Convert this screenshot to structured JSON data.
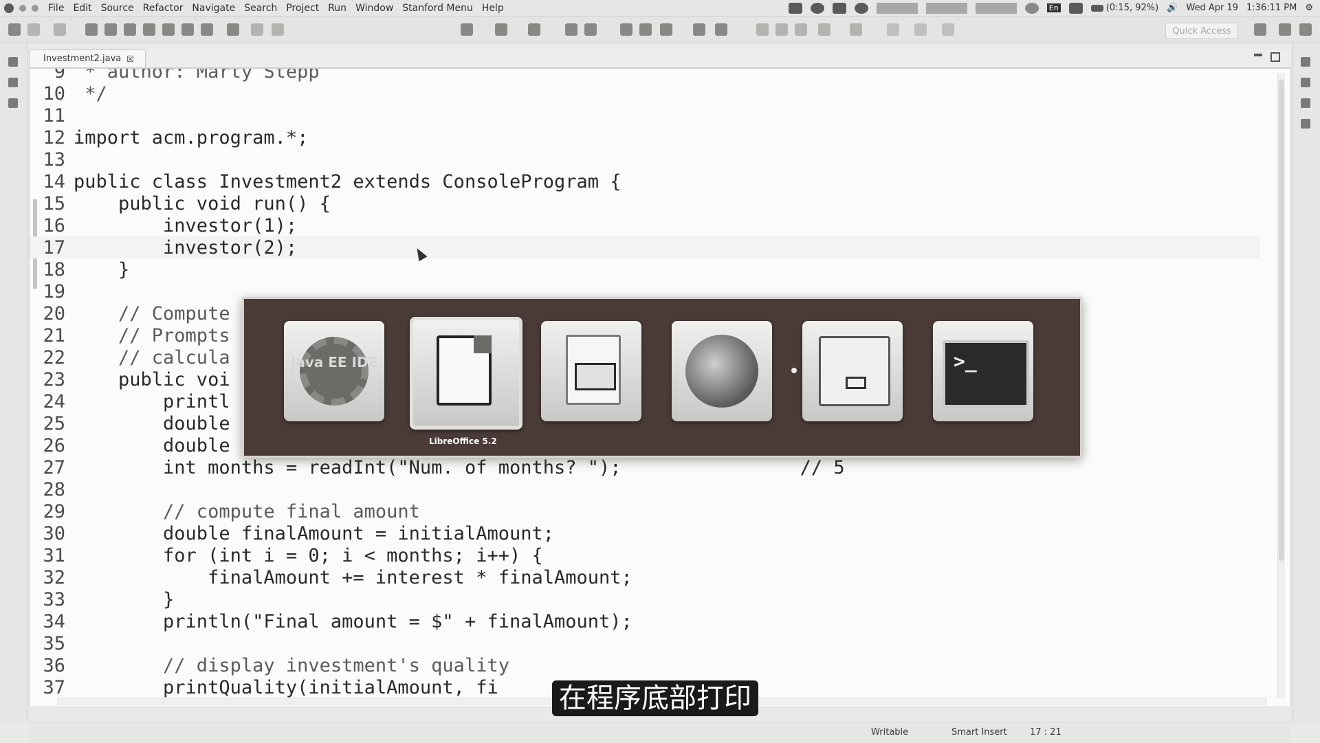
{
  "menubar": {
    "items": [
      "File",
      "Edit",
      "Source",
      "Refactor",
      "Navigate",
      "Search",
      "Project",
      "Run",
      "Window",
      "Stanford Menu",
      "Help"
    ],
    "battery": "(0:15, 92%)",
    "date": "Wed Apr 19",
    "time": "1:36:11 PM",
    "lang": "En"
  },
  "toolbar": {
    "quick_access": "Quick Access"
  },
  "editor": {
    "tab_title": "Investment2.java",
    "tab_close": "☒",
    "lines": [
      {
        "n": "9",
        "t": " * author: Marty Stepp"
      },
      {
        "n": "10",
        "t": " */"
      },
      {
        "n": "11",
        "t": ""
      },
      {
        "n": "12",
        "t": "import acm.program.*;"
      },
      {
        "n": "13",
        "t": ""
      },
      {
        "n": "14",
        "t": "public class Investment2 extends ConsoleProgram {"
      },
      {
        "n": "15",
        "t": "    public void run() {"
      },
      {
        "n": "16",
        "t": "        investor(1);"
      },
      {
        "n": "17",
        "t": "        investor(2);"
      },
      {
        "n": "18",
        "t": "    }"
      },
      {
        "n": "19",
        "t": ""
      },
      {
        "n": "20",
        "t": "    // Compute"
      },
      {
        "n": "21",
        "t": "    // Prompts"
      },
      {
        "n": "22",
        "t": "    // calcula"
      },
      {
        "n": "23",
        "t": "    public voi"
      },
      {
        "n": "24",
        "t": "        printl"
      },
      {
        "n": "25",
        "t": "        double"
      },
      {
        "n": "26",
        "t": "        double"
      },
      {
        "n": "27",
        "t": "        int months = readInt(\"Num. of months? \");                // 5"
      },
      {
        "n": "28",
        "t": ""
      },
      {
        "n": "29",
        "t": "        // compute final amount"
      },
      {
        "n": "30",
        "t": "        double finalAmount = initialAmount;"
      },
      {
        "n": "31",
        "t": "        for (int i = 0; i < months; i++) {"
      },
      {
        "n": "32",
        "t": "            finalAmount += interest * finalAmount;"
      },
      {
        "n": "33",
        "t": "        }"
      },
      {
        "n": "34",
        "t": "        println(\"Final amount = $\" + finalAmount);"
      },
      {
        "n": "35",
        "t": ""
      },
      {
        "n": "36",
        "t": "        // display investment's quality"
      },
      {
        "n": "37",
        "t": "        printQuality(initialAmount, fi"
      }
    ]
  },
  "switcher": {
    "apps": [
      {
        "name": "java-ee-ide",
        "label": "Java EE IDE"
      },
      {
        "name": "libreoffice-writer",
        "label": "LibreOffice 5.2"
      },
      {
        "name": "libreoffice-impress",
        "label": ""
      },
      {
        "name": "firefox",
        "label": ""
      },
      {
        "name": "files",
        "label": ""
      },
      {
        "name": "terminal",
        "label": ">_"
      }
    ],
    "selected_caption": "LibreOffice 5.2"
  },
  "statusbar": {
    "writable": "Writable",
    "insert_mode": "Smart Insert",
    "position": "17 : 21"
  },
  "subtitle": "在程序底部打印"
}
